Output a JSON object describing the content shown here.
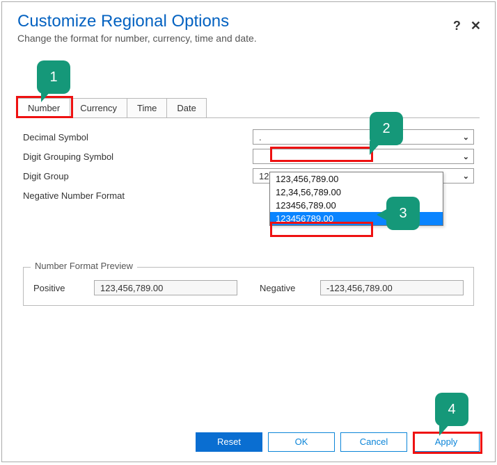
{
  "header": {
    "title": "Customize Regional Options",
    "subtitle": "Change the format for number, currency, time and date."
  },
  "tabs": [
    "Number",
    "Currency",
    "Time",
    "Date"
  ],
  "fields": {
    "decimal_symbol": {
      "label": "Decimal Symbol",
      "value": "."
    },
    "digit_grouping_symbol": {
      "label": "Digit Grouping Symbol",
      "value": ""
    },
    "digit_group": {
      "label": "Digit Group",
      "value": "123456789.00"
    },
    "negative_number_format": {
      "label": "Negative Number Format",
      "value": ""
    }
  },
  "dropdown_options": [
    "123,456,789.00",
    "12,34,56,789.00",
    "123456,789.00",
    "123456789.00"
  ],
  "preview": {
    "legend": "Number Format Preview",
    "positive_label": "Positive",
    "positive_value": "123,456,789.00",
    "negative_label": "Negative",
    "negative_value": "-123,456,789.00"
  },
  "buttons": {
    "reset": "Reset",
    "ok": "OK",
    "cancel": "Cancel",
    "apply": "Apply"
  },
  "annotations": {
    "c1": "1",
    "c2": "2",
    "c3": "3",
    "c4": "4"
  }
}
